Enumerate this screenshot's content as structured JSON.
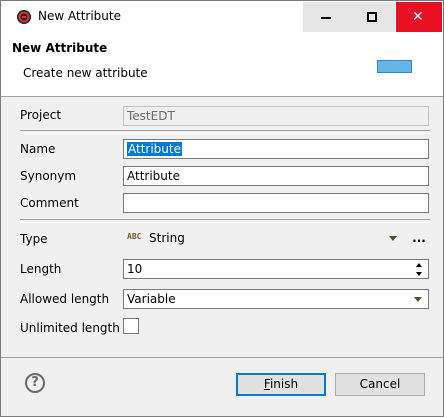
{
  "window": {
    "title": "New Attribute",
    "close_glyph": "✕"
  },
  "header": {
    "title": "New Attribute",
    "description": "Create new attribute"
  },
  "form": {
    "project": {
      "label": "Project",
      "value": "TestEDT"
    },
    "name": {
      "label": "Name",
      "value": "Attribute"
    },
    "synonym": {
      "label": "Synonym",
      "value": "Attribute"
    },
    "comment": {
      "label": "Comment",
      "value": ""
    },
    "type": {
      "label": "Type",
      "value": "String",
      "icon": "abc-string-icon",
      "icon_text": "ABC",
      "more_label": "..."
    },
    "length": {
      "label": "Length",
      "value": "10"
    },
    "allowed_length": {
      "label": "Allowed length",
      "value": "Variable"
    },
    "unlimited_length": {
      "label": "Unlimited length",
      "checked": false
    }
  },
  "footer": {
    "help_glyph": "?",
    "finish_label": "Finish",
    "cancel_label": "Cancel"
  },
  "colors": {
    "selection": "#0078d7",
    "close_button": "#e81123",
    "header_image": "#64b6e8"
  }
}
